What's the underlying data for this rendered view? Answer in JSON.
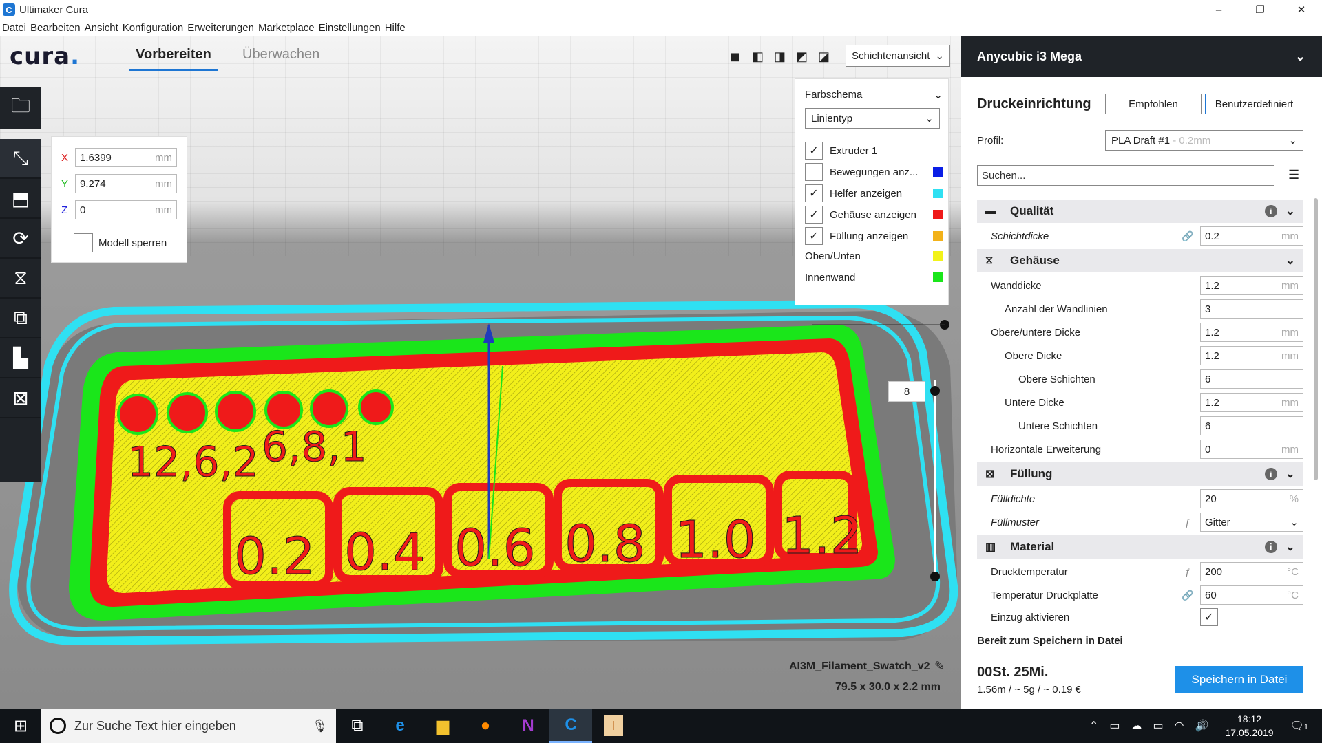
{
  "window": {
    "title": "Ultimaker Cura",
    "minimize": "–",
    "maximize": "❐",
    "close": "✕"
  },
  "menu": [
    "Datei",
    "Bearbeiten",
    "Ansicht",
    "Konfiguration",
    "Erweiterungen",
    "Marketplace",
    "Einstellungen",
    "Hilfe"
  ],
  "header": {
    "logo": "cura",
    "logo_dot": ".",
    "tab_prepare": "Vorbereiten",
    "tab_monitor": "Überwachen",
    "view_mode": "Schichtenansicht"
  },
  "move_panel": {
    "x_label": "X",
    "x_value": "1.6399",
    "y_label": "Y",
    "y_value": "9.274",
    "z_label": "Z",
    "z_value": "0",
    "unit": "mm",
    "lock_label": "Modell sperren"
  },
  "color_panel": {
    "header": "Farbschema",
    "scheme": "Linientyp",
    "items": [
      {
        "label": "Extruder 1",
        "checked": true,
        "color": ""
      },
      {
        "label": "Bewegungen anz...",
        "checked": false,
        "color": "#0a1ee6"
      },
      {
        "label": "Helfer anzeigen",
        "checked": true,
        "color": "#2fe0f2"
      },
      {
        "label": "Gehäuse anzeigen",
        "checked": true,
        "color": "#ef1a1a"
      },
      {
        "label": "Füllung anzeigen",
        "checked": true,
        "color": "#f2b21a"
      },
      {
        "label": "Oben/Unten",
        "checked": null,
        "color": "#f2f21a"
      },
      {
        "label": "Innenwand",
        "checked": null,
        "color": "#1ae61a"
      }
    ]
  },
  "model": {
    "name": "AI3M_Filament_Swatch_v2",
    "dimensions": "79.5 x 30.0 x 2.2 mm",
    "layer": "8"
  },
  "printer": {
    "name": "Anycubic i3 Mega"
  },
  "setup": {
    "title": "Druckeinrichtung",
    "mode_recommended": "Empfohlen",
    "mode_custom": "Benutzerdefiniert",
    "profile_label": "Profil:",
    "profile_value": "PLA Draft #1",
    "profile_suffix": " - 0.2mm",
    "search_placeholder": "Suchen..."
  },
  "settings": {
    "quality": {
      "label": "Qualität"
    },
    "layer_height": {
      "label": "Schichtdicke",
      "value": "0.2",
      "unit": "mm"
    },
    "shell": {
      "label": "Gehäuse"
    },
    "wall_thickness": {
      "label": "Wanddicke",
      "value": "1.2",
      "unit": "mm"
    },
    "wall_lines": {
      "label": "Anzahl der Wandlinien",
      "value": "3"
    },
    "topbottom_thickness": {
      "label": "Obere/untere Dicke",
      "value": "1.2",
      "unit": "mm"
    },
    "top_thickness": {
      "label": "Obere Dicke",
      "value": "1.2",
      "unit": "mm"
    },
    "top_layers": {
      "label": "Obere Schichten",
      "value": "6"
    },
    "bottom_thickness": {
      "label": "Untere Dicke",
      "value": "1.2",
      "unit": "mm"
    },
    "bottom_layers": {
      "label": "Untere Schichten",
      "value": "6"
    },
    "horizontal_expansion": {
      "label": "Horizontale Erweiterung",
      "value": "0",
      "unit": "mm"
    },
    "infill": {
      "label": "Füllung"
    },
    "infill_density": {
      "label": "Fülldichte",
      "value": "20",
      "unit": "%"
    },
    "infill_pattern": {
      "label": "Füllmuster",
      "value": "Gitter"
    },
    "material": {
      "label": "Material"
    },
    "print_temp": {
      "label": "Drucktemperatur",
      "value": "200",
      "unit": "°C"
    },
    "bed_temp": {
      "label": "Temperatur Druckplatte",
      "value": "60",
      "unit": "°C"
    },
    "retraction": {
      "label": "Einzug aktivieren",
      "checked": true
    }
  },
  "footer": {
    "status": "Bereit zum Speichern in Datei",
    "time": "00St. 25Mi.",
    "details": "1.56m / ~ 5g / ~ 0.19 €",
    "save_button": "Speichern in Datei"
  },
  "taskbar": {
    "search_placeholder": "Zur Suche Text hier eingeben",
    "time": "18:12",
    "date": "17.05.2019",
    "notifications": "1"
  }
}
